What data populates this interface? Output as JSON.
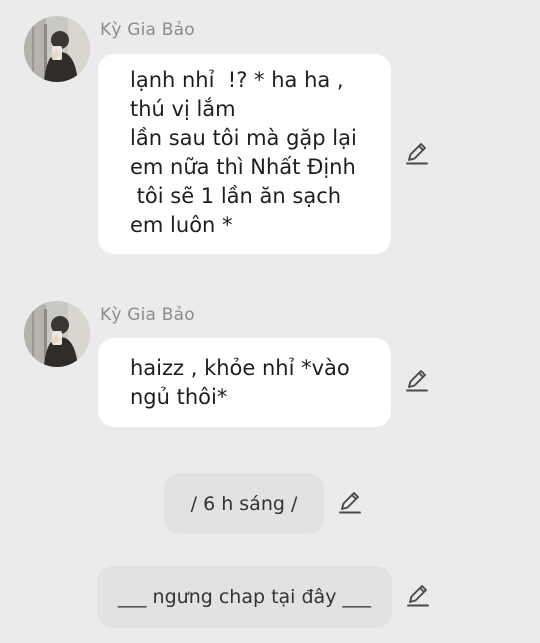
{
  "messages": [
    {
      "sender": "Kỳ Gia Bảo",
      "lines": [
        "lạnh nhỉ  !? * ha ha ,",
        "thú vị lắm",
        "lần sau tôi mà gặp lại",
        "em nữa thì Nhất Định",
        " tôi sẽ 1 lần ăn sạch",
        "em luôn *"
      ]
    },
    {
      "sender": "Kỳ Gia Bảo",
      "lines": [
        "haizz , khỏe nhỉ *vào",
        "ngủ thôi*"
      ]
    }
  ],
  "notes": [
    {
      "text": "/ 6 h sáng /"
    },
    {
      "text": "___ ngưng chap tại đây ___"
    }
  ],
  "icons": {
    "avatar": "avatar-photo",
    "edit": "pencil-edit-icon"
  }
}
